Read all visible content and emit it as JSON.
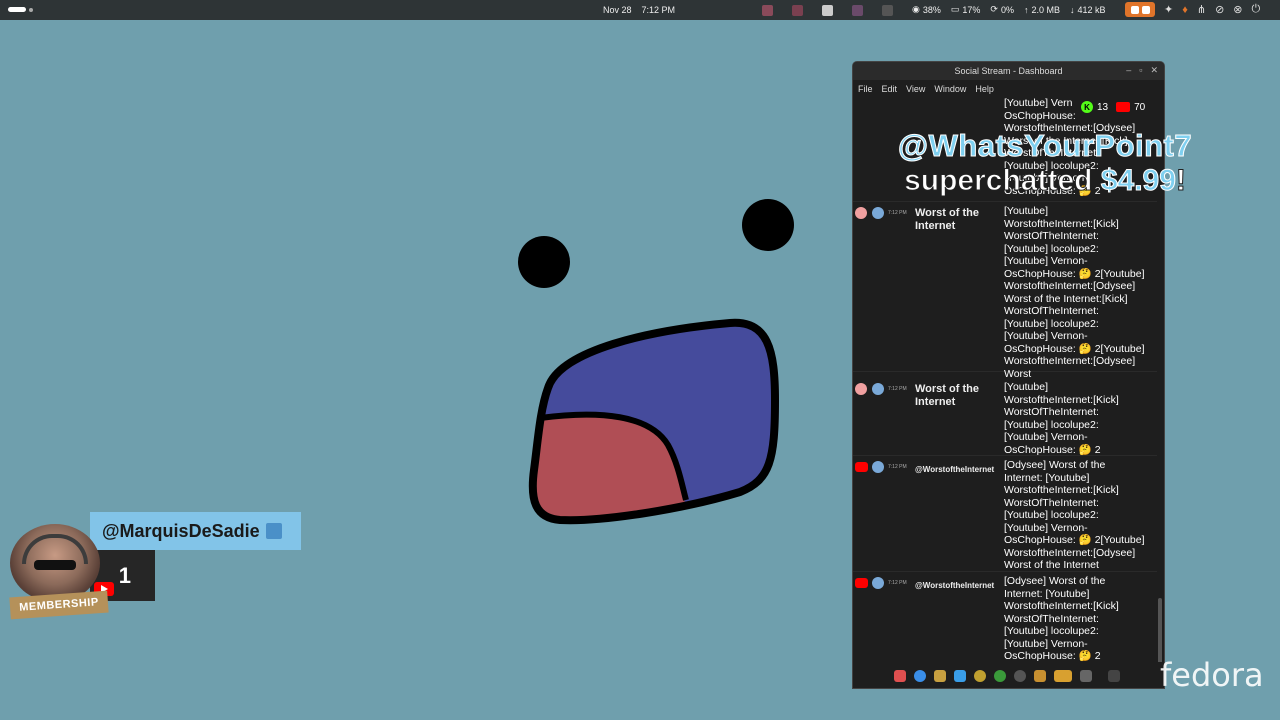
{
  "topbar": {
    "date": "Nov 28",
    "time": "7:12 PM",
    "cpu": "38%",
    "mem": "17%",
    "swap": "0%",
    "upload": "2.0 MB",
    "download": "412 kB"
  },
  "overlay": {
    "superchat_user": "@WhatsYourPoint7",
    "superchat_word": "superchatted",
    "superchat_amount": "$4.99",
    "superchat_bang": "!",
    "member_name": "@MarquisDeSadie",
    "member_count": "1",
    "member_label": "MEMBERSHIP",
    "fedora": "fedora"
  },
  "window": {
    "title": "Social Stream - Dashboard",
    "menu": [
      "File",
      "Edit",
      "View",
      "Window",
      "Help"
    ],
    "kick_count": "13",
    "youtube_count": "70",
    "kick_letter": "K"
  },
  "messages": [
    {
      "time": "7:12 PM",
      "name": "",
      "text": "[Youtube] Vern\nOsChopHouse:\nWorstoftheInternet:[Odysee]\nWorst of the Internet:[Kick]\nWorstOfTheInternet:\n[Youtube] locolupe2:\n[Youtube] Vernon-\nOsChopHouse: 🤔 2"
    },
    {
      "time": "7:12 PM",
      "name": "Worst of the Internet",
      "text": "[Youtube]\nWorstoftheInternet:[Kick]\nWorstOfTheInternet:\n[Youtube] locolupe2:\n[Youtube] Vernon-\nOsChopHouse: 🤔 2[Youtube]\nWorstoftheInternet:[Odysee]\nWorst of the Internet:[Kick]\nWorstOfTheInternet:\n[Youtube] locolupe2:\n[Youtube] Vernon-\nOsChopHouse: 🤔 2[Youtube]\nWorstoftheInternet:[Odysee]\nWorst"
    },
    {
      "time": "7:12 PM",
      "name": "Worst of the Internet",
      "text": "[Youtube]\nWorstoftheInternet:[Kick]\nWorstOfTheInternet:\n[Youtube] locolupe2:\n[Youtube] Vernon-\nOsChopHouse: 🤔 2"
    },
    {
      "time": "7:12 PM",
      "name": "@WorstoftheInternet",
      "text": "[Odysee] Worst of the\nInternet: [Youtube]\nWorstoftheInternet:[Kick]\nWorstOfTheInternet:\n[Youtube] locolupe2:\n[Youtube] Vernon-\nOsChopHouse: 🤔 2[Youtube]\nWorstoftheInternet:[Odysee]\nWorst of the Internet"
    },
    {
      "time": "7:12 PM",
      "name": "@WorstoftheInternet",
      "text": "[Odysee] Worst of the\nInternet: [Youtube]\nWorstoftheInternet:[Kick]\nWorstOfTheInternet:\n[Youtube] locolupe2:\n[Youtube] Vernon-\nOsChopHouse: 🤔 2"
    }
  ],
  "colors": {
    "background": "#6f9fad",
    "mouth_top": "#454b9c",
    "mouth_bottom": "#b04e55",
    "superchat_blue": "#7fd0f0"
  }
}
